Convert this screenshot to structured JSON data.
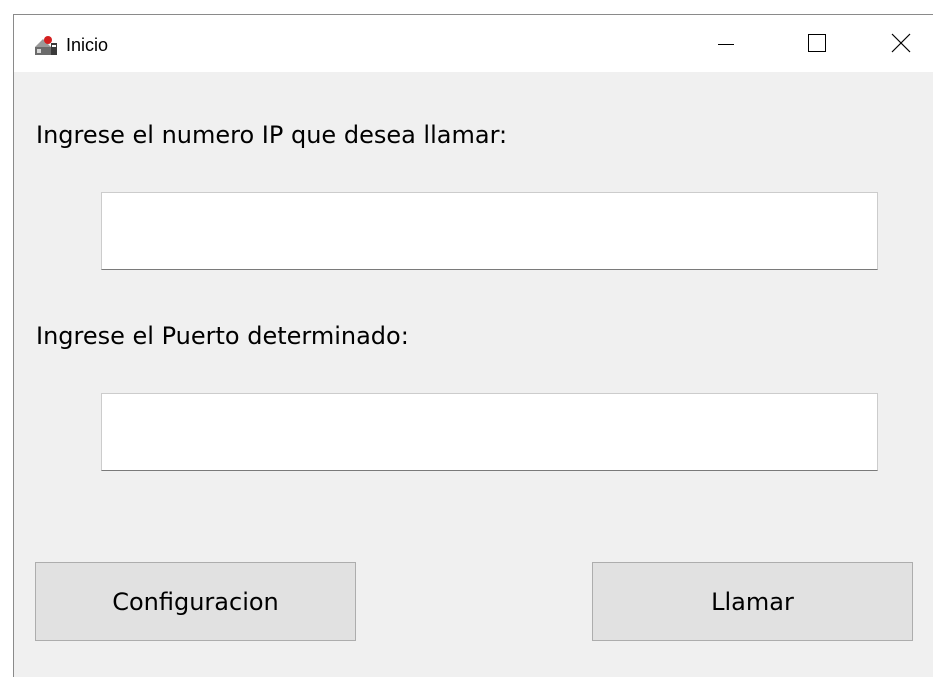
{
  "window": {
    "title": "Inicio",
    "icon": "java-app-icon",
    "controls": {
      "minimize_icon": "minimize-icon",
      "maximize_icon": "maximize-icon",
      "close_icon": "close-icon"
    }
  },
  "form": {
    "ip_label": "Ingrese el numero IP que desea llamar:",
    "ip_value": "",
    "port_label": "Ingrese el Puerto determinado:",
    "port_value": ""
  },
  "buttons": {
    "config_label": "Configuracion",
    "call_label": "Llamar"
  },
  "colors": {
    "window_background": "#f0f0f0",
    "titlebar_background": "#ffffff",
    "button_background": "#e1e1e1",
    "button_border": "#adadad"
  }
}
